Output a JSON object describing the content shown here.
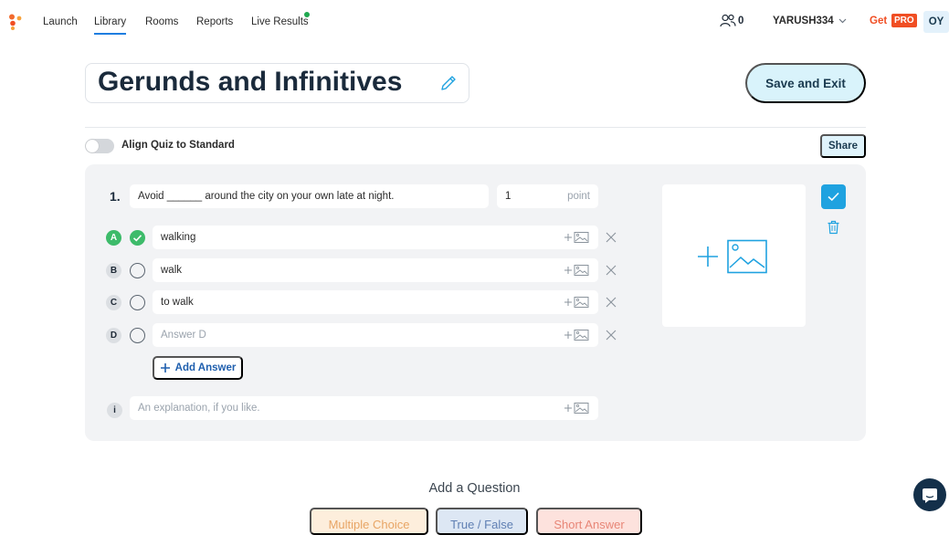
{
  "nav": {
    "items": [
      {
        "label": "Launch",
        "active": false
      },
      {
        "label": "Library",
        "active": true
      },
      {
        "label": "Rooms",
        "active": false
      },
      {
        "label": "Reports",
        "active": false
      },
      {
        "label": "Live Results",
        "active": false
      }
    ],
    "roster_count": "0",
    "username": "YARUSH334",
    "get_label": "Get",
    "pro_label": "PRO",
    "avatar_initials": "OY"
  },
  "quiz": {
    "title": "Gerunds and Infinitives",
    "save_exit_label": "Save and Exit",
    "align_label": "Align Quiz to Standard",
    "align_enabled": false,
    "share_label": "Share"
  },
  "question": {
    "number": "1.",
    "text": "Avoid ______ around the city on your own late at night.",
    "points_value": "1",
    "points_unit": "point",
    "answers": [
      {
        "letter": "A",
        "value": "walking",
        "placeholder": "",
        "correct": true
      },
      {
        "letter": "B",
        "value": "walk",
        "placeholder": "",
        "correct": false
      },
      {
        "letter": "C",
        "value": "to walk",
        "placeholder": "",
        "correct": false
      },
      {
        "letter": "D",
        "value": "",
        "placeholder": "Answer D",
        "correct": false
      }
    ],
    "add_answer_label": "Add Answer",
    "explanation_marker": "i",
    "explanation_placeholder": "An explanation, if you like."
  },
  "add_question": {
    "heading": "Add a Question",
    "types": [
      "Multiple Choice",
      "True / False",
      "Short Answer"
    ]
  },
  "colors": {
    "accent": "#1fa2e0",
    "correct": "#3dbb6a",
    "pro_badge": "#f04e23",
    "card_bg": "#f2f3f5"
  },
  "icons": {
    "logo": "socrative-logo-icon",
    "roster": "people-icon",
    "image": "image-icon",
    "remove": "close-icon",
    "delete": "trash-icon",
    "chat": "chat-icon"
  }
}
